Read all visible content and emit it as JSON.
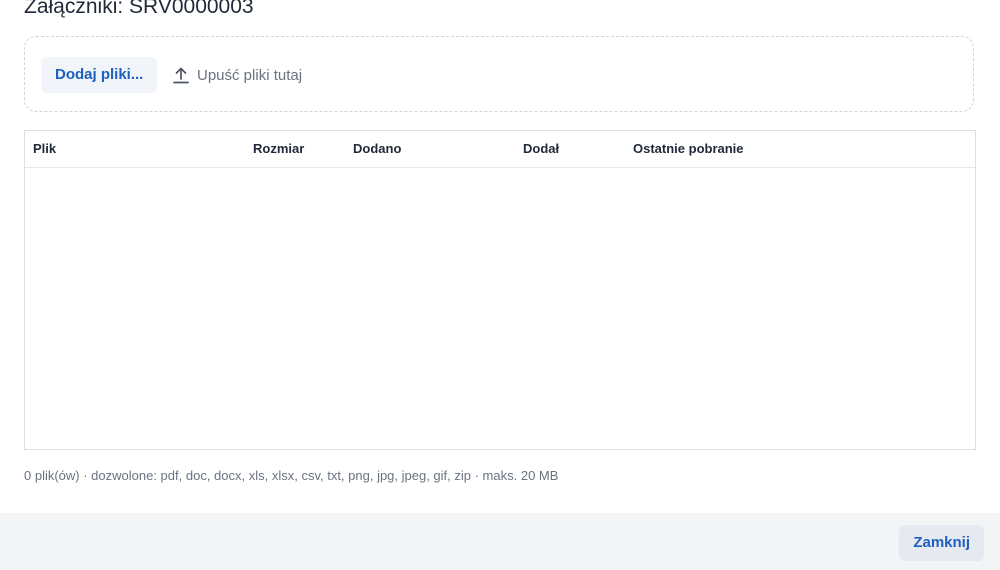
{
  "dialog": {
    "title": "Załączniki: SRV0000003"
  },
  "dropzone": {
    "add_button_label": "Dodaj pliki...",
    "upload_icon": "upload-icon",
    "drop_hint": "Upuść pliki tutaj"
  },
  "table": {
    "columns": [
      "Plik",
      "Rozmiar",
      "Dodano",
      "Dodał",
      "Ostatnie pobranie"
    ],
    "rows": []
  },
  "footer": {
    "info": "0 plik(ów) · dozwolone: pdf, doc, docx, xls, xlsx, csv, txt, png, jpg, jpeg, gif, zip · maks. 20 MB"
  },
  "actions": {
    "close_label": "Zamknij"
  },
  "colors": {
    "accent": "#1f5fbf",
    "button_bg": "#f1f4f8",
    "action_bar_bg": "#f3f4f6"
  }
}
